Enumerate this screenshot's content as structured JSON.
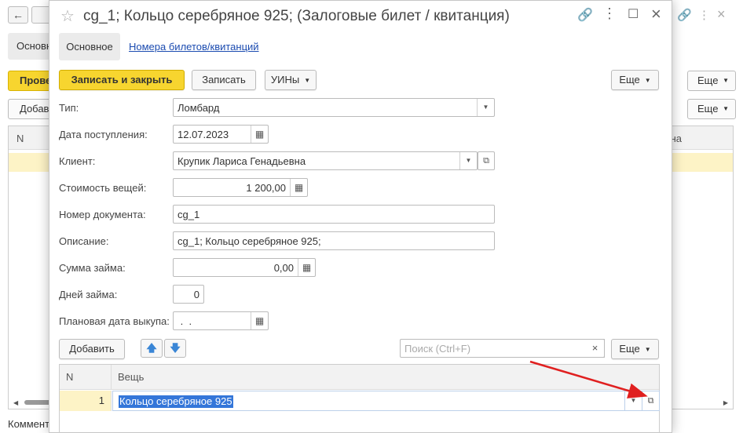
{
  "background": {
    "tab_main": "Основн",
    "post_button": "Прове",
    "add_button": "Добав",
    "more_label": "Еще",
    "grid_col_n": "N",
    "grid_col_right": "на",
    "comment_label": "Коммент"
  },
  "form": {
    "title": "cg_1; Кольцо серебряное 925; (Залоговые билет / квитанция)",
    "tabs": {
      "main": "Основное",
      "numbers": "Номера билетов/квитанций"
    },
    "toolbar": {
      "save_close": "Записать и закрыть",
      "save": "Записать",
      "uins": "УИНы",
      "more": "Еще"
    },
    "fields": {
      "type_label": "Тип:",
      "type_value": "Ломбард",
      "date_label": "Дата поступления:",
      "date_value": "12.07.2023",
      "client_label": "Клиент:",
      "client_value": "Крупик Лариса Генадьевна",
      "cost_label": "Стоимость вещей:",
      "cost_value": "1 200,00",
      "docnum_label": "Номер документа:",
      "docnum_value": "cg_1",
      "desc_label": "Описание:",
      "desc_value": "cg_1; Кольцо серебряное 925;",
      "loan_label": "Сумма займа:",
      "loan_value": "0,00",
      "days_label": "Дней займа:",
      "days_value": "0",
      "redeem_label": "Плановая дата выкупа:",
      "redeem_value": " .  ."
    },
    "table_toolbar": {
      "add": "Добавить",
      "search_placeholder": "Поиск (Ctrl+F)",
      "more": "Еще"
    },
    "table": {
      "columns": [
        "N",
        "Вещь"
      ],
      "rows": [
        {
          "n": "1",
          "item": "Кольцо серебряное 925"
        }
      ]
    }
  },
  "colors": {
    "accent": "#f7d52f",
    "link": "#1b4bb0",
    "selection": "#3476d9",
    "row_highlight": "#fdf3c6",
    "annotation_arrow": "#e02020"
  }
}
